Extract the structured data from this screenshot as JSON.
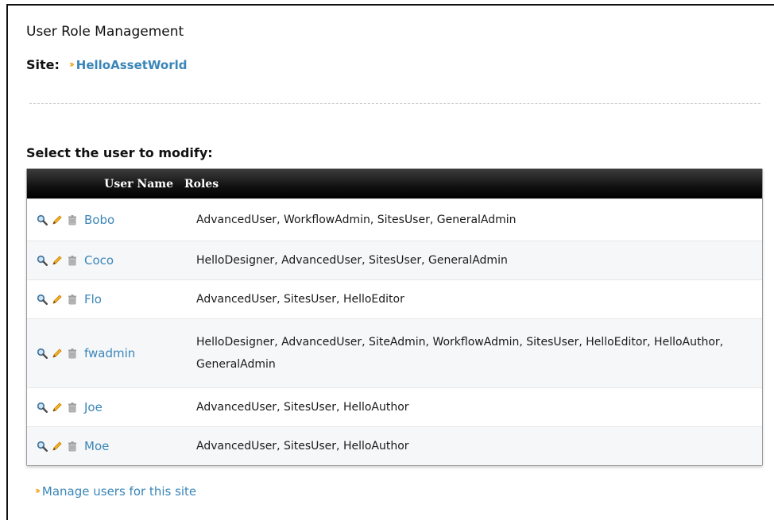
{
  "page": {
    "title": "User Role Management",
    "site_label": "Site:",
    "site_name": "HelloAssetWorld",
    "select_label": "Select the user to modify:",
    "manage_link": "Manage users for this site"
  },
  "table": {
    "headers": {
      "user_name": "User Name",
      "roles": "Roles"
    },
    "rows": [
      {
        "user": "Bobo",
        "roles": "AdvancedUser, WorkflowAdmin, SitesUser, GeneralAdmin"
      },
      {
        "user": "Coco",
        "roles": "HelloDesigner, AdvancedUser, SitesUser, GeneralAdmin"
      },
      {
        "user": "Flo",
        "roles": "AdvancedUser, SitesUser, HelloEditor"
      },
      {
        "user": "fwadmin",
        "roles": "HelloDesigner, AdvancedUser, SiteAdmin, WorkflowAdmin, SitesUser, HelloEditor, HelloAuthor, GeneralAdmin"
      },
      {
        "user": "Joe",
        "roles": "AdvancedUser, SitesUser, HelloAuthor"
      },
      {
        "user": "Moe",
        "roles": "AdvancedUser, SitesUser, HelloAuthor"
      }
    ],
    "row_icons": [
      "magnifier-icon",
      "pencil-icon",
      "trash-icon"
    ]
  },
  "colors": {
    "link": "#3a86b8",
    "arrow": "#f0a21e",
    "header_bg": "#111111"
  }
}
